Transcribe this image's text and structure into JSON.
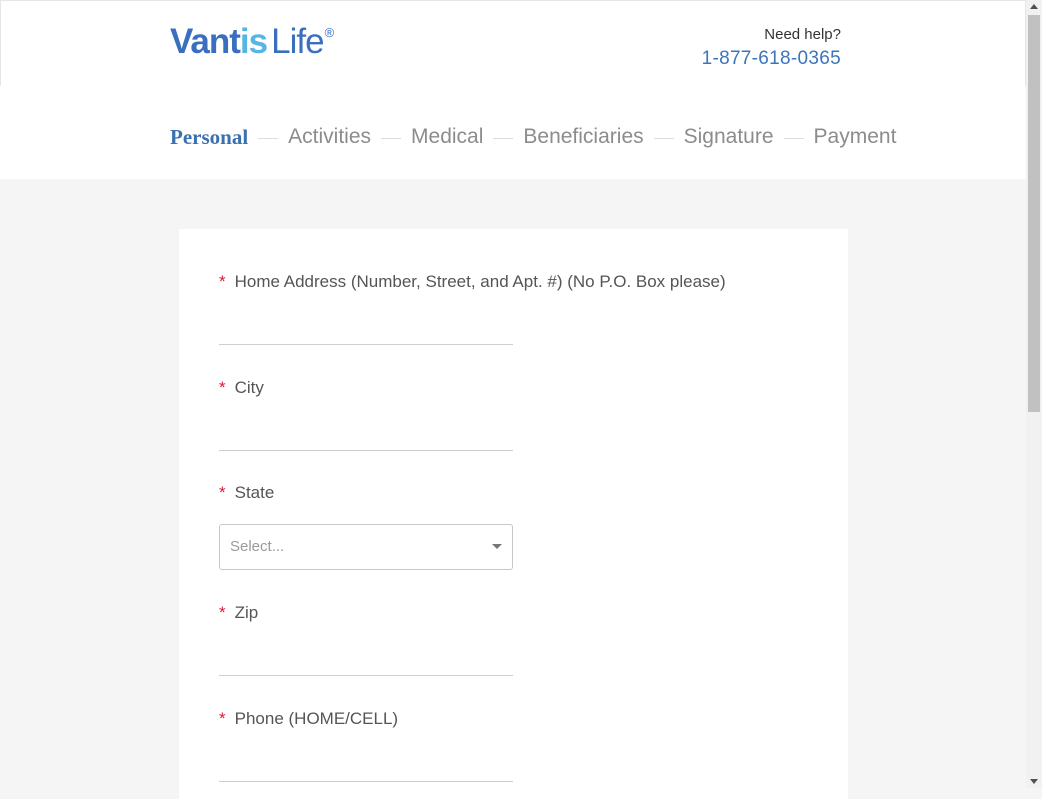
{
  "header": {
    "logo": {
      "part1": "Vant",
      "part2": "is",
      "part3": "Life",
      "reg": "®"
    },
    "help_label": "Need help?",
    "phone": "1-877-618-0365"
  },
  "steps": [
    {
      "label": "Personal",
      "active": true
    },
    {
      "label": "Activities",
      "active": false
    },
    {
      "label": "Medical",
      "active": false
    },
    {
      "label": "Beneficiaries",
      "active": false
    },
    {
      "label": "Signature",
      "active": false
    },
    {
      "label": "Payment",
      "active": false
    }
  ],
  "form": {
    "required_mark": "*",
    "address": {
      "label": "Home Address (Number, Street, and Apt. #) (No P.O. Box please)",
      "value": ""
    },
    "city": {
      "label": "City",
      "value": ""
    },
    "state": {
      "label": "State",
      "placeholder": "Select..."
    },
    "zip": {
      "label": "Zip",
      "value": ""
    },
    "phone": {
      "label": "Phone (HOME/CELL)",
      "value": ""
    }
  },
  "colors": {
    "brand_blue": "#3a6fc0",
    "brand_light_blue": "#55b6e6",
    "required": "#e0153a",
    "page_bg": "#f5f5f5"
  }
}
